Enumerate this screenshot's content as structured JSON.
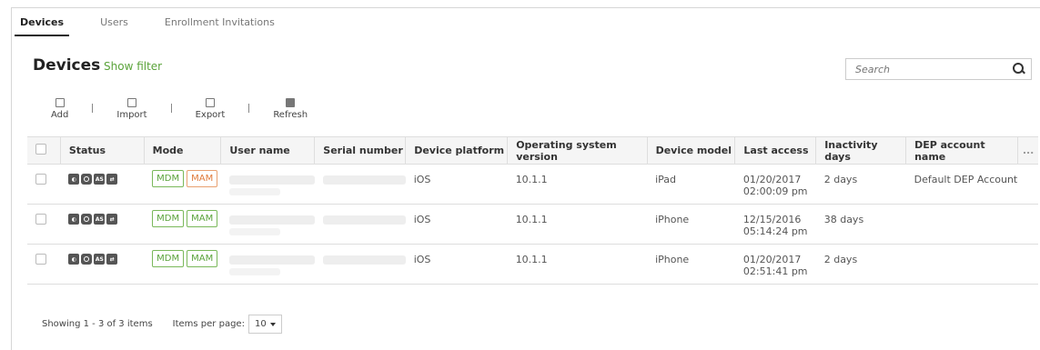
{
  "tabs": [
    {
      "label": "Devices",
      "active": true
    },
    {
      "label": "Users",
      "active": false
    },
    {
      "label": "Enrollment Invitations",
      "active": false
    }
  ],
  "page": {
    "title": "Devices",
    "show_filter": "Show filter"
  },
  "search": {
    "placeholder": "Search"
  },
  "toolbar": {
    "add": "Add",
    "import": "Import",
    "export": "Export",
    "refresh": "Refresh"
  },
  "table": {
    "columns": [
      "Status",
      "Mode",
      "User name",
      "Serial number",
      "Device platform",
      "Operating system version",
      "Device model",
      "Last access",
      "Inactivity days",
      "DEP account name",
      "..."
    ],
    "rows": [
      {
        "mode": [
          "MDM",
          "MAM"
        ],
        "platform": "iOS",
        "os_version": "10.1.1",
        "model": "iPad",
        "last_access_date": "01/20/2017",
        "last_access_time": "02:00:09 pm",
        "inactivity": "2 days",
        "dep": "Default DEP Account"
      },
      {
        "mode": [
          "MDM",
          "MAM"
        ],
        "platform": "iOS",
        "os_version": "10.1.1",
        "model": "iPhone",
        "last_access_date": "12/15/2016",
        "last_access_time": "05:14:24 pm",
        "inactivity": "38 days",
        "dep": ""
      },
      {
        "mode": [
          "MDM",
          "MAM"
        ],
        "platform": "iOS",
        "os_version": "10.1.1",
        "model": "iPhone",
        "last_access_date": "01/20/2017",
        "last_access_time": "02:51:41 pm",
        "inactivity": "2 days",
        "dep": ""
      }
    ]
  },
  "status_icon_text": "AS",
  "footer": {
    "showing": "Showing 1 - 3 of 3 items",
    "per_page_label": "Items per page:",
    "per_page_value": "10"
  },
  "colors": {
    "accent_green": "#5aa33a",
    "warn_orange": "#e07a3a"
  }
}
